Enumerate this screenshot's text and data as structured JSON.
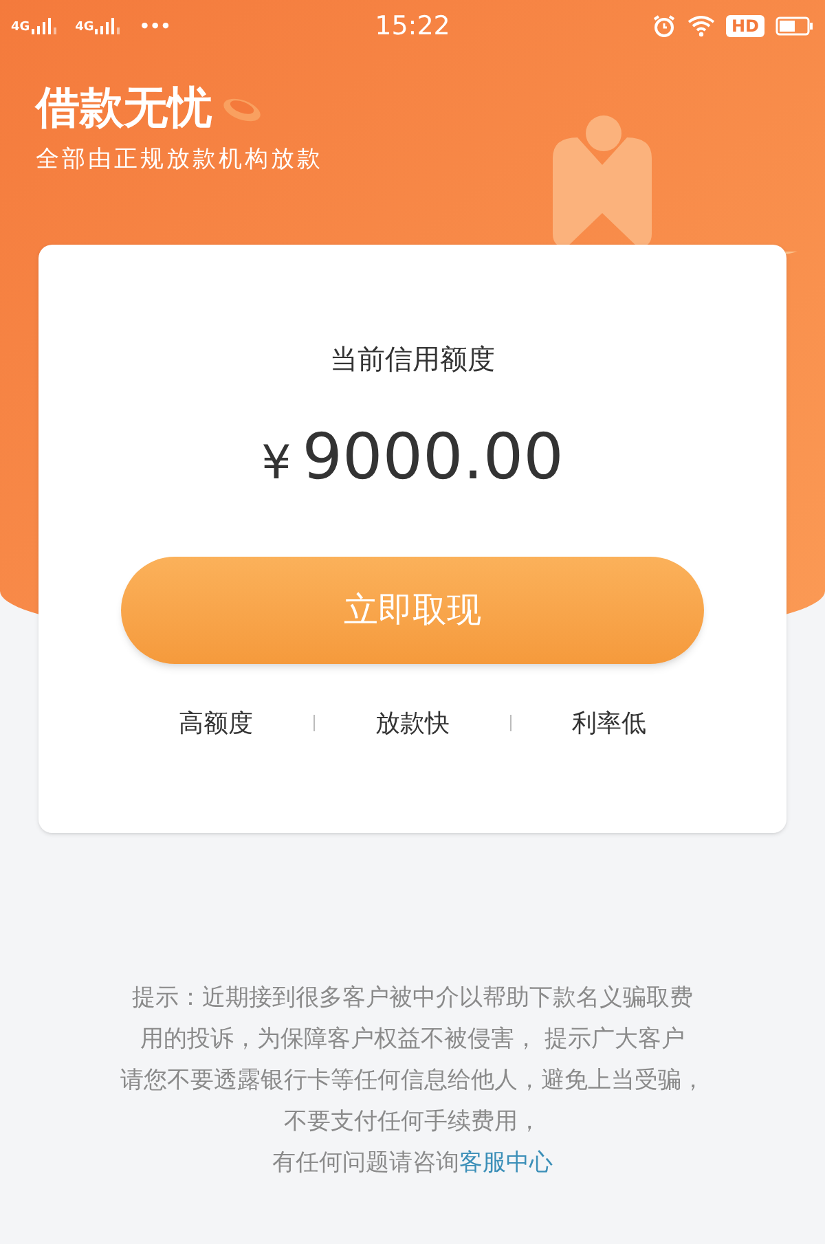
{
  "status_bar": {
    "network_1": "4G",
    "network_2": "4G",
    "more": "•••",
    "time": "15:22",
    "hd": "HD"
  },
  "header": {
    "title": "借款无忧",
    "subtitle": "全部由正规放款机构放款"
  },
  "card": {
    "label": "当前信用额度",
    "currency": "¥",
    "amount": "9000.00",
    "button": "立即取现",
    "features": [
      "高额度",
      "放款快",
      "利率低"
    ]
  },
  "notice": {
    "lines": [
      "提示：近期接到很多客户被中介以帮助下款名义骗取费",
      "用的投诉，为保障客户权益不被侵害， 提示广大客户",
      "请您不要透露银行卡等任何信息给他人，避免上当受骗，",
      "不要支付任何手续费用，"
    ],
    "contact_prefix": "有任何问题请咨询",
    "contact_link": "客服中心"
  }
}
